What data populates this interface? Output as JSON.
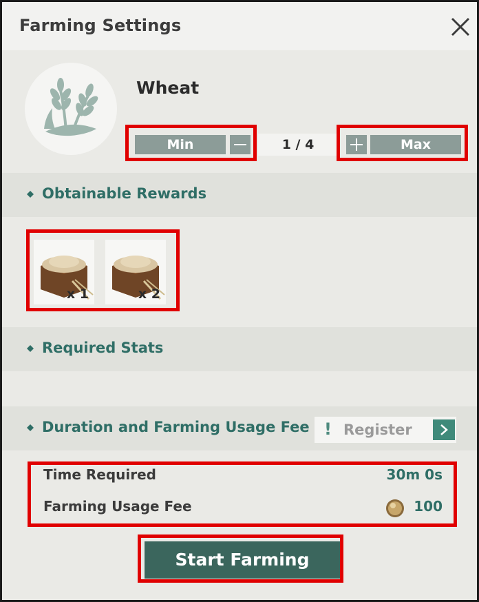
{
  "window": {
    "title": "Farming Settings"
  },
  "crop": {
    "name": "Wheat",
    "icon": "wheat-icon"
  },
  "quantity": {
    "min_label": "Min",
    "max_label": "Max",
    "display": "1 / 4",
    "current": 1,
    "max": 4
  },
  "sections": {
    "rewards": "Obtainable Rewards",
    "stats": "Required Stats",
    "duration": "Duration and Farming Usage Fee"
  },
  "rewards": [
    {
      "icon": "grain-crate-icon",
      "qty": "x 1"
    },
    {
      "icon": "grain-crate-icon",
      "qty": "x 2"
    }
  ],
  "register": {
    "label": "Register",
    "alert_glyph": "!"
  },
  "info": {
    "time_label": "Time Required",
    "time_value": "30m 0s",
    "fee_label": "Farming Usage Fee",
    "fee_value": "100"
  },
  "start_button": "Start Farming",
  "colors": {
    "accent_teal": "#2f6e66",
    "button_grey": "#8c9c98",
    "start_button": "#3b665d",
    "highlight": "#e00000"
  }
}
